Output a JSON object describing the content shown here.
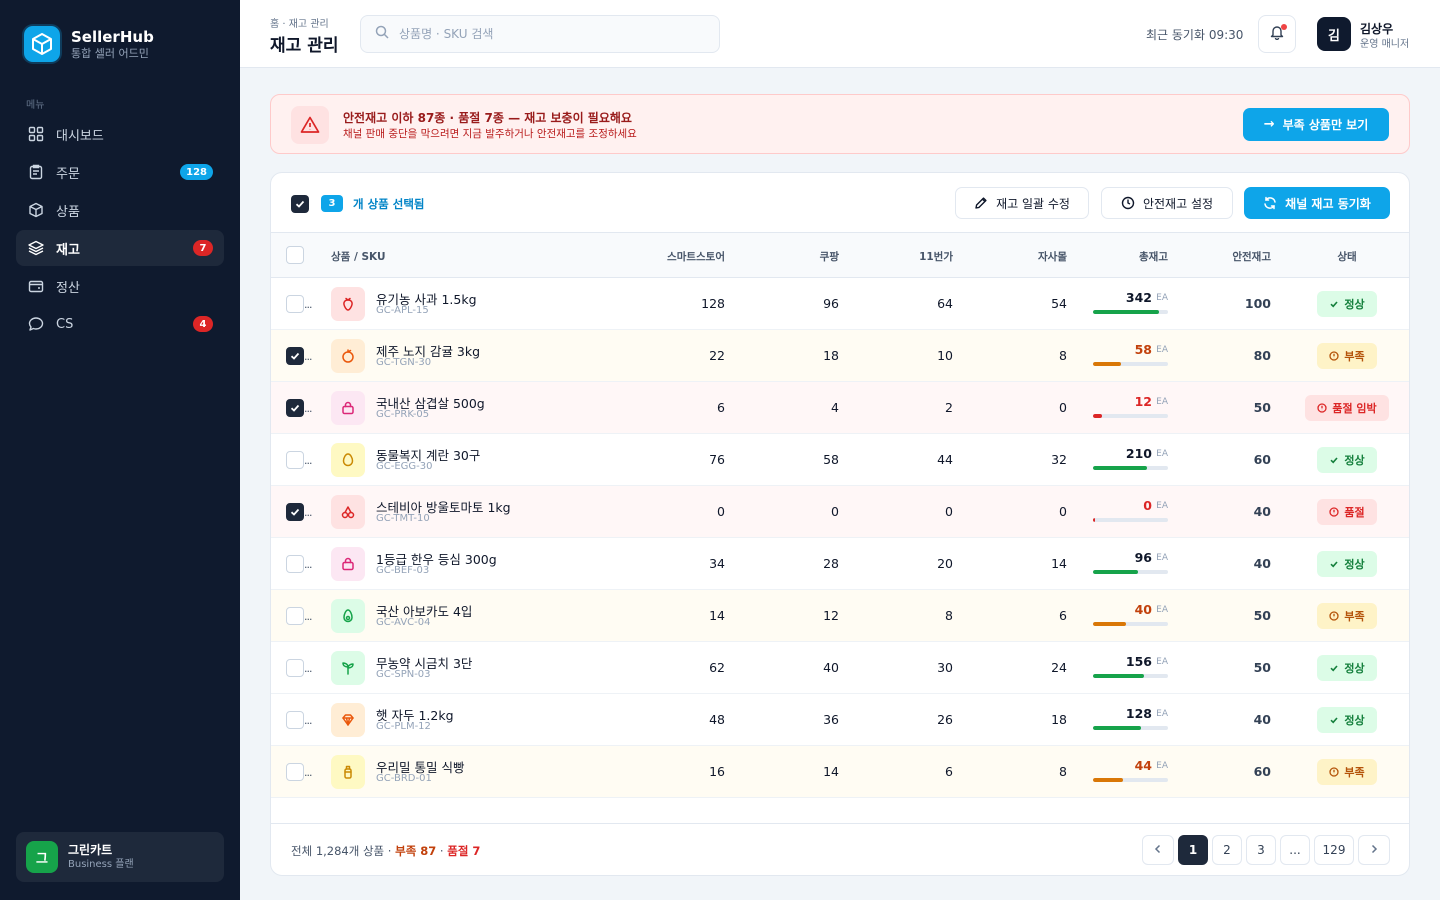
{
  "sidebar": {
    "brand_name": "SellerHub",
    "brand_sub": "통합 셀러 어드민",
    "menu_label": "메뉴",
    "items": [
      {
        "label": "대시보드",
        "icon": "grid-icon",
        "badge": ""
      },
      {
        "label": "주문",
        "icon": "clipboard-icon",
        "badge": "128"
      },
      {
        "label": "상품",
        "icon": "box-icon",
        "badge": ""
      },
      {
        "label": "재고",
        "icon": "layers-icon",
        "badge": "7",
        "active": true
      },
      {
        "label": "정산",
        "icon": "wallet-icon",
        "badge": ""
      },
      {
        "label": "CS",
        "icon": "chat-icon",
        "badge": "4"
      }
    ],
    "store": {
      "avatar": "그",
      "name": "그린카트",
      "plan": "Business 플랜"
    }
  },
  "header": {
    "breadcrumb": "홈 · 재고 관리",
    "title": "재고 관리",
    "search_placeholder": "상품명 · SKU 검색",
    "sync_text": "최근 동기화 09:30",
    "user_initial": "김",
    "user_name": "김상우",
    "user_role": "운영 매니저"
  },
  "alert": {
    "title": "안전재고 이하 87종 · 품절 7종 — 재고 보충이 필요해요",
    "subtitle": "채널 판매 중단을 막으려면 지금 발주하거나 안전재고를 조정하세요",
    "button": "부족 상품만 보기"
  },
  "toolbar": {
    "selected_count": "3",
    "selected_text": "개 상품 선택됨",
    "bulk_edit": "재고 일괄 수정",
    "safety_setting": "안전재고 설정",
    "sync_button": "채널 재고 동기화"
  },
  "columns": {
    "product": "상품 / SKU",
    "smartstore": "스마트스토어",
    "coupang": "쿠팡",
    "st11": "11번가",
    "own": "자사몰",
    "total": "총재고",
    "safety": "안전재고",
    "status": "상태"
  },
  "unit": "EA",
  "rows": [
    {
      "name": "유기농 사과 1.5kg",
      "sku": "GC-APL-15",
      "icon": "strawberry-icon",
      "smart": "128",
      "coupang": "96",
      "st11": "64",
      "own": "54",
      "total": "342",
      "safety": "100",
      "status": "정상",
      "level": "ok",
      "checked": false,
      "fill": 0.88
    },
    {
      "name": "제주 노지 감귤 3kg",
      "sku": "GC-TGN-30",
      "icon": "orange-icon",
      "smart": "22",
      "coupang": "18",
      "st11": "10",
      "own": "8",
      "total": "58",
      "safety": "80",
      "status": "부족",
      "level": "warn",
      "checked": true,
      "fill": 0.37
    },
    {
      "name": "국내산 삼겹살 500g",
      "sku": "GC-PRK-05",
      "icon": "bag-icon",
      "smart": "6",
      "coupang": "4",
      "st11": "2",
      "own": "0",
      "total": "12",
      "safety": "50",
      "status": "품절 임박",
      "level": "danger",
      "checked": true,
      "fill": 0.12
    },
    {
      "name": "동물복지 계란 30구",
      "sku": "GC-EGG-30",
      "icon": "egg-icon",
      "smart": "76",
      "coupang": "58",
      "st11": "44",
      "own": "32",
      "total": "210",
      "safety": "60",
      "status": "정상",
      "level": "ok",
      "checked": false,
      "fill": 0.72
    },
    {
      "name": "스테비아 방울토마토 1kg",
      "sku": "GC-TMT-10",
      "icon": "cherry-icon",
      "smart": "0",
      "coupang": "0",
      "st11": "0",
      "own": "0",
      "total": "0",
      "safety": "40",
      "status": "품절",
      "level": "out",
      "checked": true,
      "fill": 0.02
    },
    {
      "name": "1등급 한우 등심 300g",
      "sku": "GC-BEF-03",
      "icon": "bag-icon",
      "smart": "34",
      "coupang": "28",
      "st11": "20",
      "own": "14",
      "total": "96",
      "safety": "40",
      "status": "정상",
      "level": "ok",
      "checked": false,
      "fill": 0.6
    },
    {
      "name": "국산 아보카도 4입",
      "sku": "GC-AVC-04",
      "icon": "avocado-icon",
      "smart": "14",
      "coupang": "12",
      "st11": "8",
      "own": "6",
      "total": "40",
      "safety": "50",
      "status": "부족",
      "level": "warn",
      "checked": false,
      "fill": 0.44
    },
    {
      "name": "무농약 시금치 3단",
      "sku": "GC-SPN-03",
      "icon": "sprout-icon",
      "smart": "62",
      "coupang": "40",
      "st11": "30",
      "own": "24",
      "total": "156",
      "safety": "50",
      "status": "정상",
      "level": "ok",
      "checked": false,
      "fill": 0.68
    },
    {
      "name": "햇 자두 1.2kg",
      "sku": "GC-PLM-12",
      "icon": "gem-icon",
      "smart": "48",
      "coupang": "36",
      "st11": "26",
      "own": "18",
      "total": "128",
      "safety": "40",
      "status": "정상",
      "level": "ok",
      "checked": false,
      "fill": 0.64
    },
    {
      "name": "우리밀 통밀 식빵",
      "sku": "GC-BRD-01",
      "icon": "bottle-icon",
      "smart": "16",
      "coupang": "14",
      "st11": "6",
      "own": "8",
      "total": "44",
      "safety": "60",
      "status": "부족",
      "level": "warn",
      "checked": false,
      "fill": 0.4
    }
  ],
  "footer": {
    "total_text": "전체 1,284개 상품 · ",
    "short_text": "부족 87",
    "sep": " · ",
    "out_text": "품절 7"
  },
  "pagination": {
    "pages": [
      "1",
      "2",
      "3",
      "...",
      "129"
    ],
    "current": "1"
  },
  "colors": {
    "accent": "#0ea5e9",
    "sidebar_bg": "#0f1a2e",
    "ok": "#16a34a",
    "warn": "#c2410c",
    "danger": "#dc2626"
  }
}
